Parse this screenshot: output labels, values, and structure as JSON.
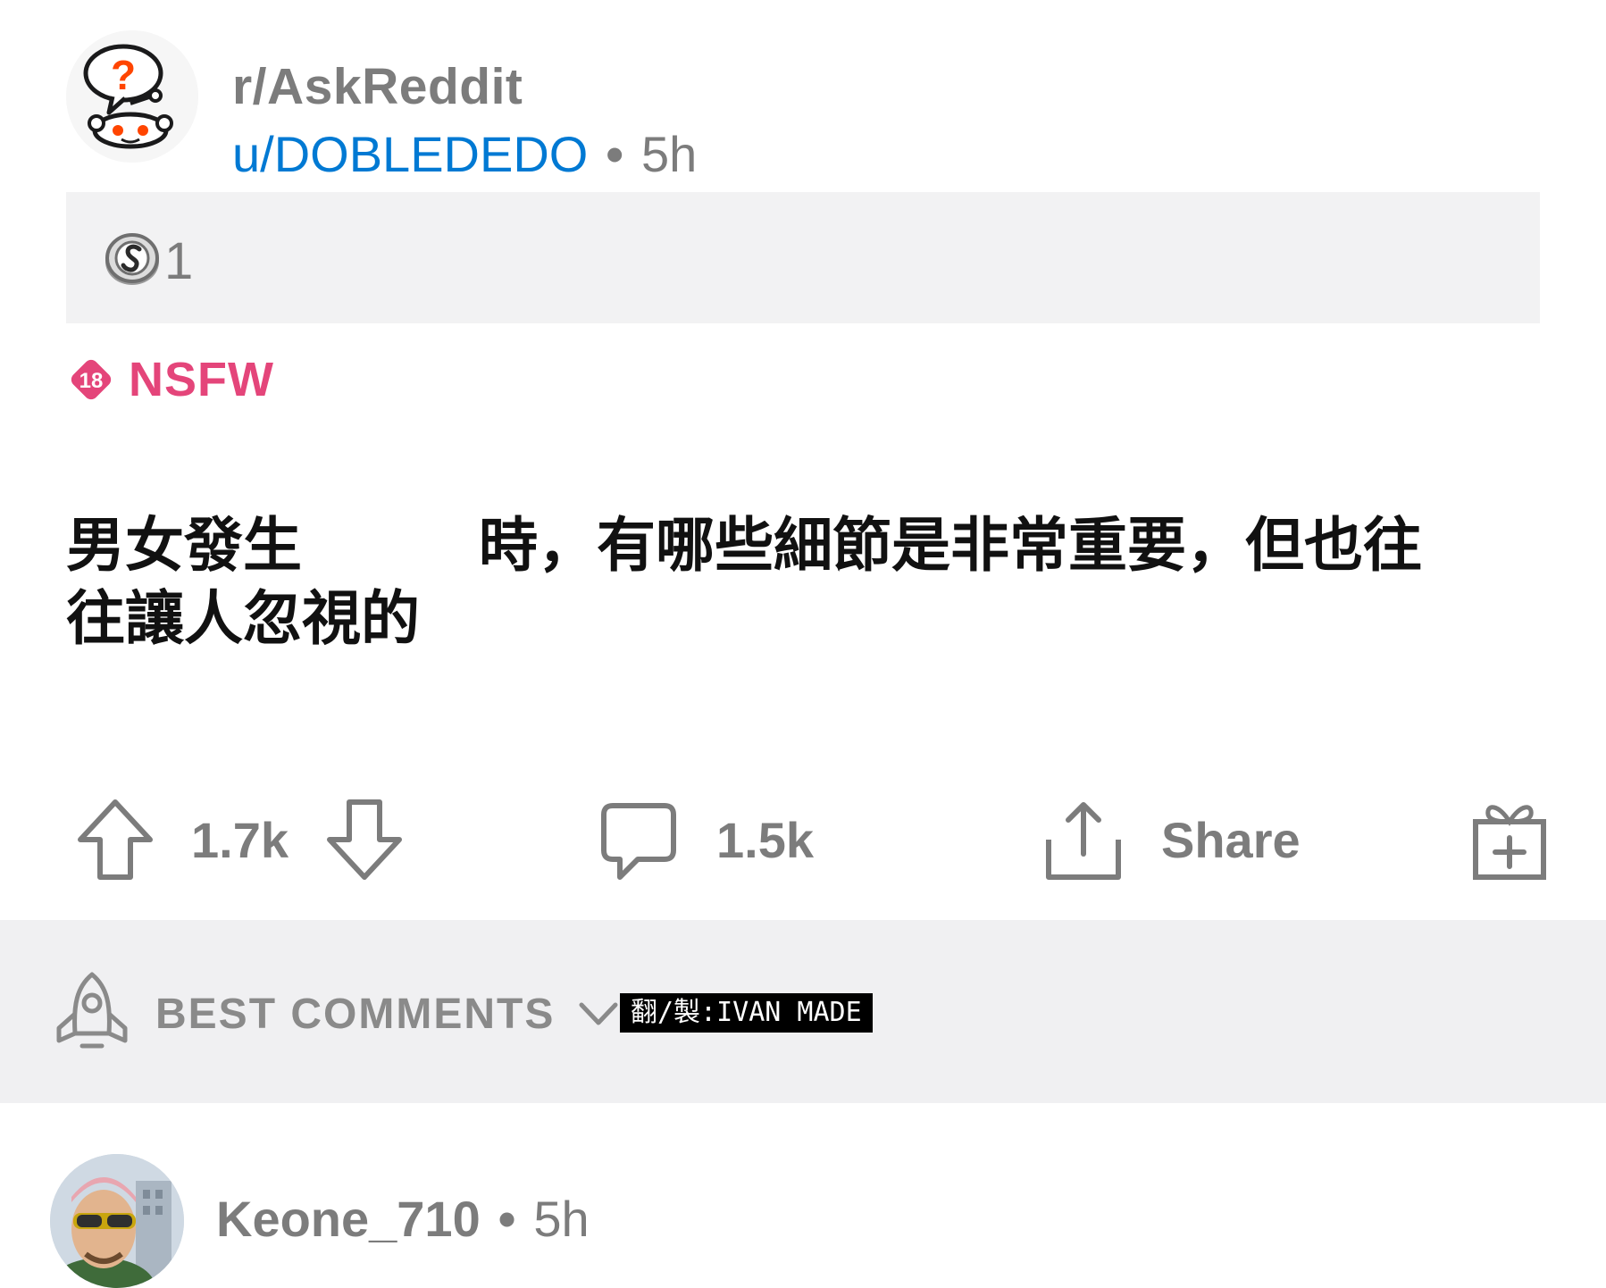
{
  "post": {
    "subreddit": "r/AskReddit",
    "author": "u/DOBLEDEDO",
    "separator": "•",
    "age": "5h",
    "award_count": "1",
    "nsfw_badge_text": "18",
    "nsfw_label": "NSFW",
    "title": "男女發生　　　時，有哪些細節是非常重要，但也往往讓人忽視的"
  },
  "actions": {
    "upvotes": "1.7k",
    "comments": "1.5k",
    "share_label": "Share"
  },
  "comments_section": {
    "sort_label": "BEST COMMENTS",
    "watermark": "翻/製:IVAN MADE"
  },
  "first_comment": {
    "username": "Keone_710",
    "separator": "•",
    "age": "5h"
  },
  "icons": {
    "subreddit_avatar": "askreddit-snoo-icon",
    "award": "silver-award-icon",
    "nsfw": "nsfw-18-badge-icon",
    "upvote": "upvote-arrow-icon",
    "downvote": "downvote-arrow-icon",
    "comment": "comment-bubble-icon",
    "share": "share-icon",
    "gift": "gift-award-icon",
    "sort": "rocket-icon",
    "chevron": "chevron-down-icon"
  },
  "colors": {
    "author_link": "#0079d3",
    "nsfw": "#e4457a",
    "muted_text": "#7c7c7c",
    "award_box_bg": "#f2f2f3",
    "comments_bar_bg": "#f0f0f2"
  }
}
